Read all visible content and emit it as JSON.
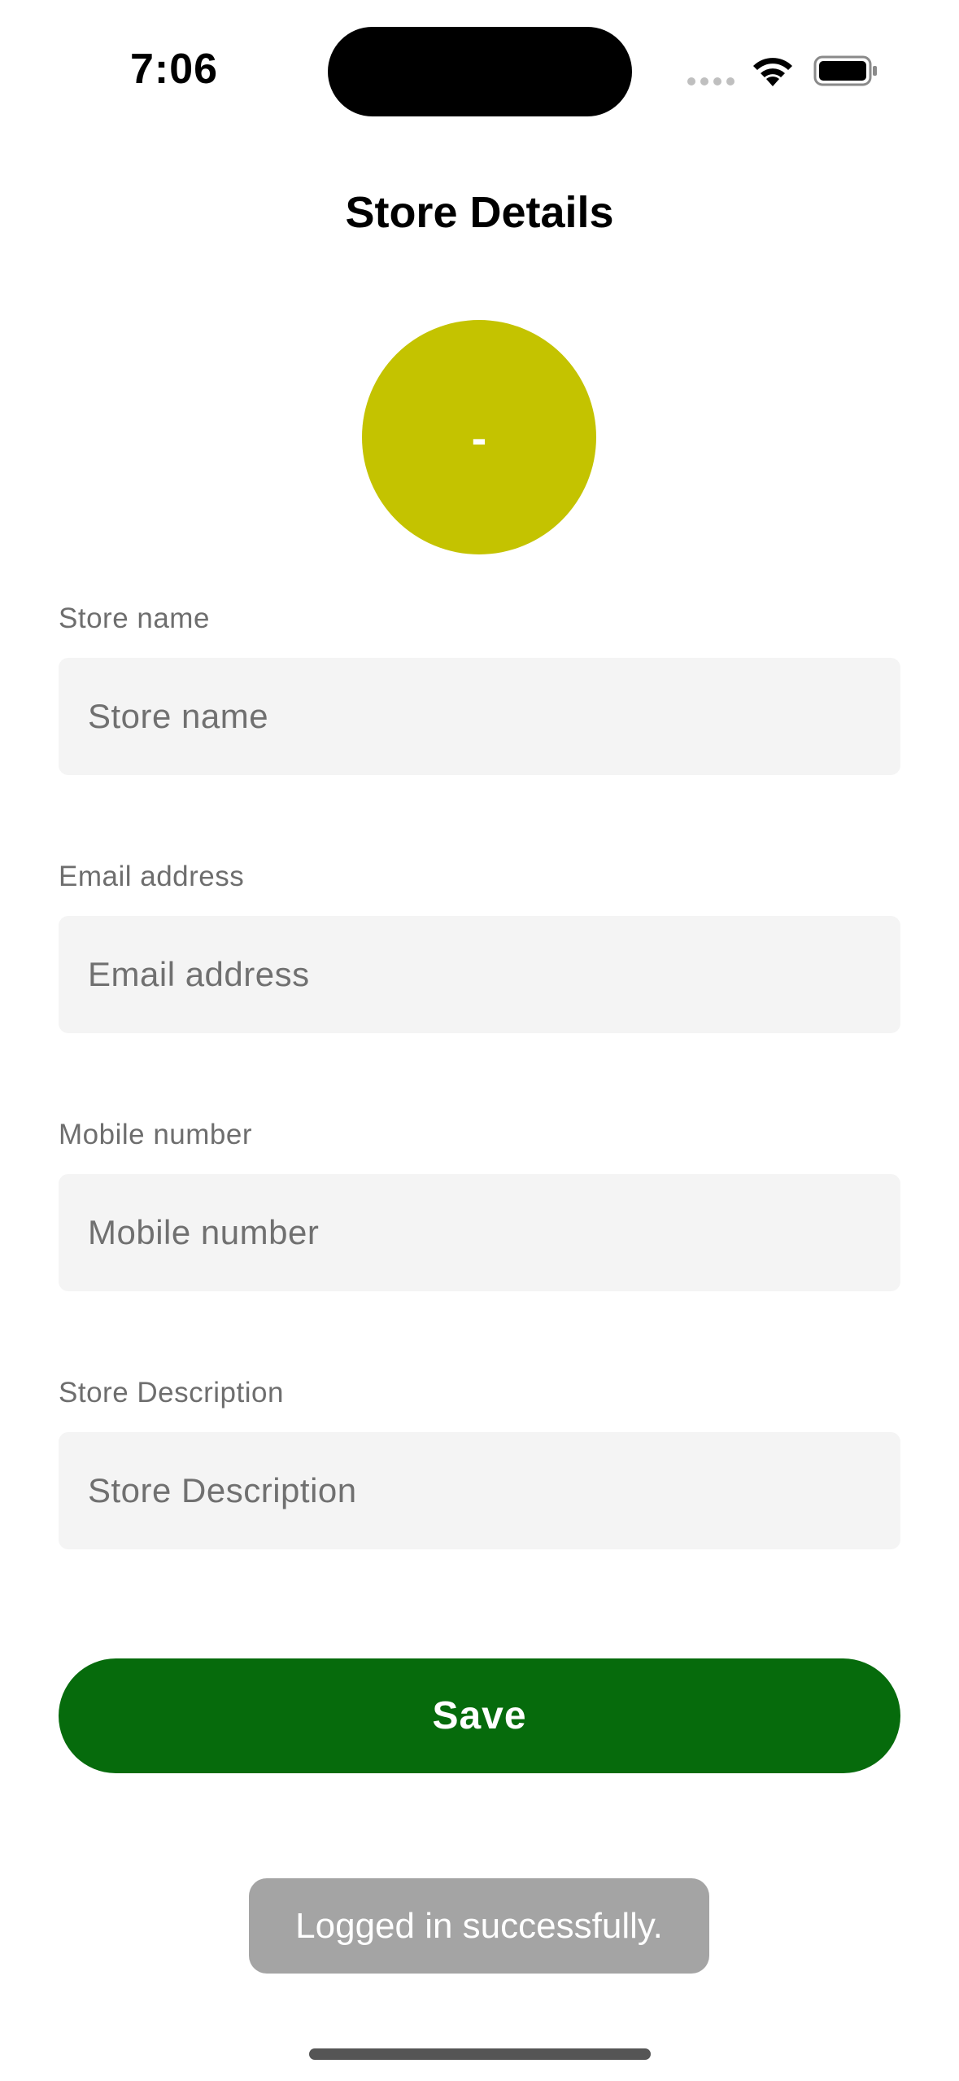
{
  "status_bar": {
    "time": "7:06"
  },
  "header": {
    "title": "Store Details"
  },
  "avatar": {
    "initials": "-",
    "color": "#c4c300"
  },
  "form": {
    "store_name": {
      "label": "Store name",
      "placeholder": "Store name",
      "value": ""
    },
    "email": {
      "label": "Email address",
      "placeholder": "Email address",
      "value": ""
    },
    "mobile": {
      "label": "Mobile number",
      "placeholder": "Mobile number",
      "value": ""
    },
    "description": {
      "label": "Store Description",
      "placeholder": "Store Description",
      "value": ""
    }
  },
  "actions": {
    "save_label": "Save",
    "save_color": "#066b0c"
  },
  "toast": {
    "message": "Logged in successfully."
  }
}
